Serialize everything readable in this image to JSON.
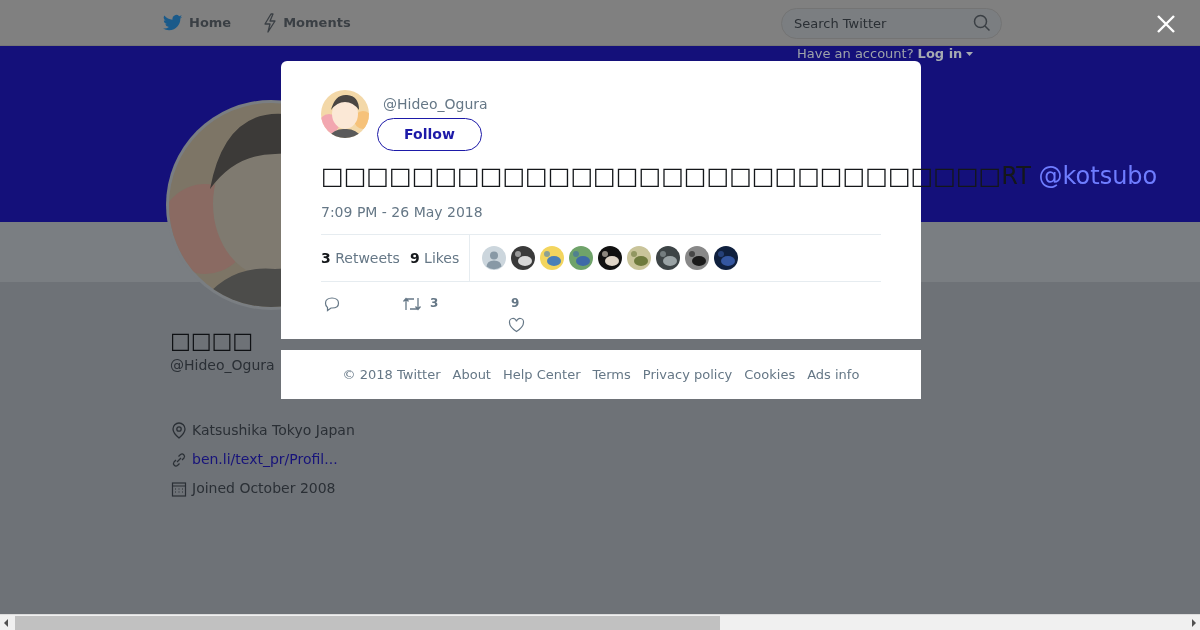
{
  "nav": {
    "items": [
      {
        "label": "Home"
      },
      {
        "label": "Moments"
      }
    ]
  },
  "search": {
    "placeholder": "Search Twitter"
  },
  "login_prompt": {
    "text": "Have an account?",
    "link": "Log in"
  },
  "profile": {
    "name": "□□□□",
    "handle": "@Hideo_Ogura",
    "location": "Katsushika Tokyo Japan",
    "url": "ben.li/text_pr/Profil...",
    "joined": "Joined October 2008"
  },
  "tweet": {
    "handle": "@Hideo_Ogura",
    "follow_button": "Follow",
    "text": "□□□□□□□□□□□□□□□□□□□□□□□□□□□□□□RT ",
    "mention": "@kotsubo",
    "timestamp": "7:09 PM - 26 May 2018",
    "stats": [
      {
        "count": "3",
        "label": "Retweets"
      },
      {
        "count": "9",
        "label": "Likes"
      }
    ],
    "likers": [
      {
        "kind": "default"
      },
      {
        "kind": "picture"
      },
      {
        "kind": "picture"
      },
      {
        "kind": "picture"
      },
      {
        "kind": "picture"
      },
      {
        "kind": "picture"
      },
      {
        "kind": "picture"
      },
      {
        "kind": "picture"
      },
      {
        "kind": "picture"
      }
    ],
    "actions": {
      "retweet_count": "3",
      "like_count": "9"
    }
  },
  "footer": [
    "© 2018 Twitter",
    "About",
    "Help Center",
    "Terms",
    "Privacy policy",
    "Cookies",
    "Ads info"
  ]
}
